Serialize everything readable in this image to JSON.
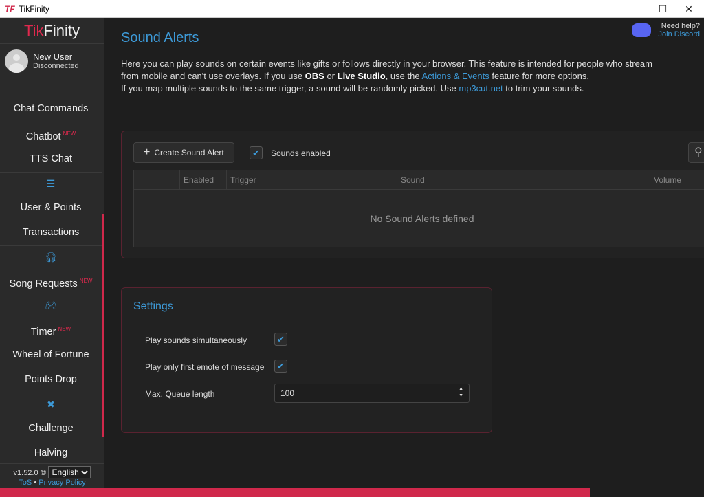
{
  "window": {
    "title": "TikFinity",
    "logo": "TF"
  },
  "brand": {
    "part1": "Tik",
    "part2": "Finity"
  },
  "user": {
    "name": "New User",
    "status": "Disconnected"
  },
  "sidebar": {
    "items": [
      {
        "label": "Chat Commands"
      },
      {
        "label": "Chatbot",
        "badge": "NEW"
      },
      {
        "label": "TTS Chat"
      },
      {
        "label": "User & Points"
      },
      {
        "label": "Transactions"
      },
      {
        "label": "Song Requests",
        "badge": "NEW"
      },
      {
        "label": "Timer",
        "badge": "NEW"
      },
      {
        "label": "Wheel of Fortune"
      },
      {
        "label": "Points Drop"
      },
      {
        "label": "Challenge"
      },
      {
        "label": "Halving"
      }
    ],
    "version": "v1.52.0",
    "language": "English",
    "tos": "ToS",
    "privacy": "Privacy Policy"
  },
  "header": {
    "title": "Sound Alerts",
    "help": "Need help?",
    "discord": "Join Discord"
  },
  "intro": {
    "t1": "Here you can play sounds on certain events like gifts or follows directly in your browser. This feature is intended for people who stream from mobile and can't use overlays. If you use ",
    "obs": "OBS",
    "t2": " or ",
    "ls": "Live Studio",
    "t3": ", use the ",
    "ae": "Actions & Events",
    "t4": " feature for more options.",
    "t5": "If you map multiple sounds to the same trigger, a sound will be randomly picked. Use ",
    "mp3": "mp3cut.net",
    "t6": " to trim your sounds."
  },
  "alerts": {
    "create": "Create Sound Alert",
    "sounds_enabled": "Sounds enabled",
    "sounds_enabled_checked": true,
    "columns": [
      "",
      "Enabled",
      "Trigger",
      "Sound",
      "Volume"
    ],
    "empty": "No Sound Alerts defined"
  },
  "settings": {
    "title": "Settings",
    "simultaneous": "Play sounds simultaneously",
    "simultaneous_checked": true,
    "first_emote": "Play only first emote of message",
    "first_emote_checked": true,
    "queue_label": "Max. Queue length",
    "queue_value": "100"
  },
  "progress": {
    "percent": 83.8
  },
  "colors": {
    "accent": "#d0284b",
    "link": "#3d9ad8"
  }
}
